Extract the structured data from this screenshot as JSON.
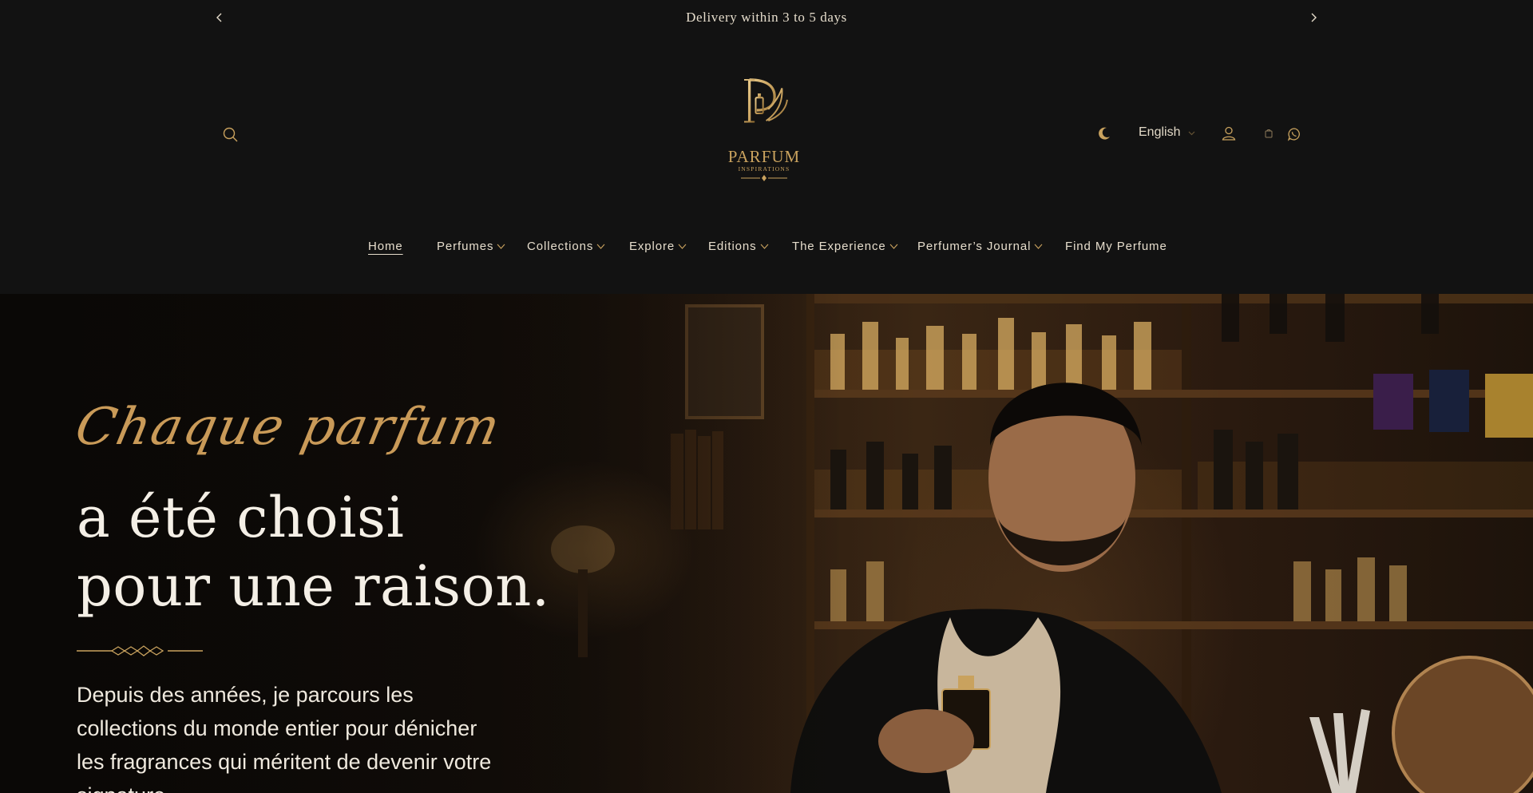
{
  "announcement": {
    "message": "Delivery within 3 to 5 days",
    "prev_icon": "chevron-left-icon",
    "next_icon": "chevron-right-icon"
  },
  "header": {
    "logo": {
      "wordmark": "PARFUM",
      "subtitle": "INSPIRATIONS"
    },
    "language": "English",
    "icons": [
      "search-icon",
      "moon-icon",
      "account-icon",
      "cart-icon",
      "whatsapp-icon"
    ]
  },
  "nav": {
    "items": [
      {
        "label": "Home",
        "active": true,
        "dropdown": false
      },
      {
        "label": "Perfumes",
        "active": false,
        "dropdown": true
      },
      {
        "label": "Collections",
        "active": false,
        "dropdown": true
      },
      {
        "label": "Explore",
        "active": false,
        "dropdown": true
      },
      {
        "label": "Editions",
        "active": false,
        "dropdown": true
      },
      {
        "label": "The Experience",
        "active": false,
        "dropdown": true
      },
      {
        "label": "Perfumer’s Journal",
        "active": false,
        "dropdown": true
      },
      {
        "label": "Find My Perfume",
        "active": false,
        "dropdown": false
      }
    ]
  },
  "hero": {
    "script_line": "Chaque parfum",
    "headline_1": "a été choisi",
    "headline_2": "pour une raison.",
    "body": "Depuis des années, je parcours les collections du monde entier pour dénicher les fragrances qui méritent de devenir votre signature."
  },
  "colors": {
    "background": "#121212",
    "gold_accent": "#c9a25e",
    "text_light": "#e6ddcc"
  }
}
